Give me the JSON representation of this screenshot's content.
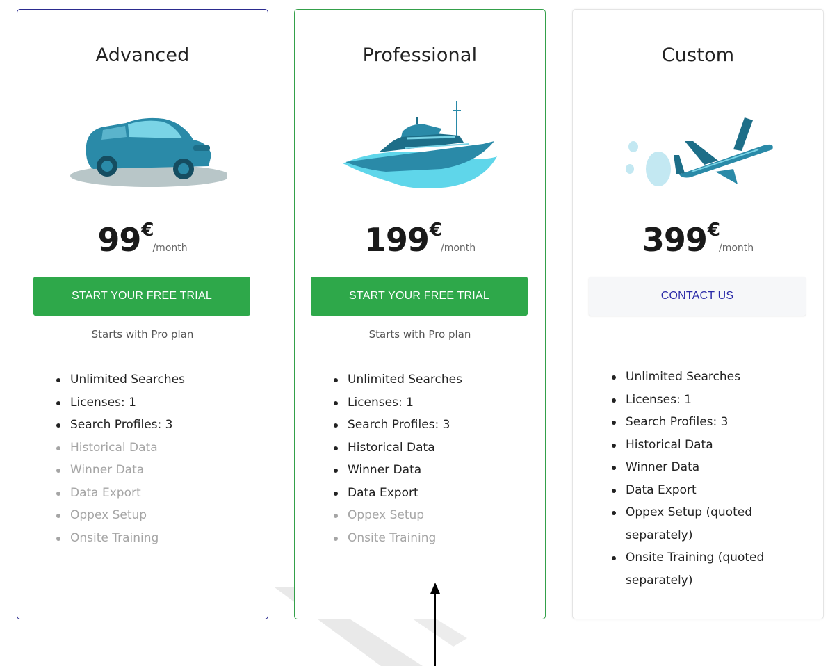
{
  "plans": [
    {
      "title": "Advanced",
      "illustration": "car-icon",
      "price": "99",
      "currency": "€",
      "period": "/month",
      "cta": "START YOUR FREE TRIAL",
      "note": "Starts with Pro plan",
      "features": [
        {
          "label": "Unlimited Searches",
          "enabled": true
        },
        {
          "label": "Licenses: 1",
          "enabled": true
        },
        {
          "label": "Search Profiles: 3",
          "enabled": true
        },
        {
          "label": "Historical Data",
          "enabled": false
        },
        {
          "label": "Winner Data",
          "enabled": false
        },
        {
          "label": "Data Export",
          "enabled": false
        },
        {
          "label": "Oppex Setup",
          "enabled": false
        },
        {
          "label": "Onsite Training",
          "enabled": false
        }
      ]
    },
    {
      "title": "Professional",
      "illustration": "yacht-icon",
      "price": "199",
      "currency": "€",
      "period": "/month",
      "cta": "START YOUR FREE TRIAL",
      "note": "Starts with Pro plan",
      "features": [
        {
          "label": "Unlimited Searches",
          "enabled": true
        },
        {
          "label": "Licenses: 1",
          "enabled": true
        },
        {
          "label": "Search Profiles: 3",
          "enabled": true
        },
        {
          "label": "Historical Data",
          "enabled": true
        },
        {
          "label": "Winner Data",
          "enabled": true
        },
        {
          "label": "Data Export",
          "enabled": true
        },
        {
          "label": "Oppex Setup",
          "enabled": false
        },
        {
          "label": "Onsite Training",
          "enabled": false
        }
      ]
    },
    {
      "title": "Custom",
      "illustration": "airplane-icon",
      "price": "399",
      "currency": "€",
      "period": "/month",
      "cta": "CONTACT US",
      "features": [
        {
          "label": "Unlimited Searches",
          "enabled": true
        },
        {
          "label": "Licenses: 1",
          "enabled": true
        },
        {
          "label": "Search Profiles: 3",
          "enabled": true
        },
        {
          "label": "Historical Data",
          "enabled": true
        },
        {
          "label": "Winner Data",
          "enabled": true
        },
        {
          "label": "Data Export",
          "enabled": true
        },
        {
          "label": "Oppex Setup (quoted separately)",
          "enabled": true
        },
        {
          "label": "Onsite Training (quoted separately)",
          "enabled": true
        }
      ]
    }
  ],
  "colors": {
    "primary_button": "#2ea84a",
    "contact_text": "#2b2ba8",
    "advanced_border": "#2b2b8f",
    "professional_border": "#34a04a",
    "disabled_feature": "#a5a5a5",
    "illustration_teal": "#2a8aa8",
    "water_cyan": "#5fd6ea"
  }
}
